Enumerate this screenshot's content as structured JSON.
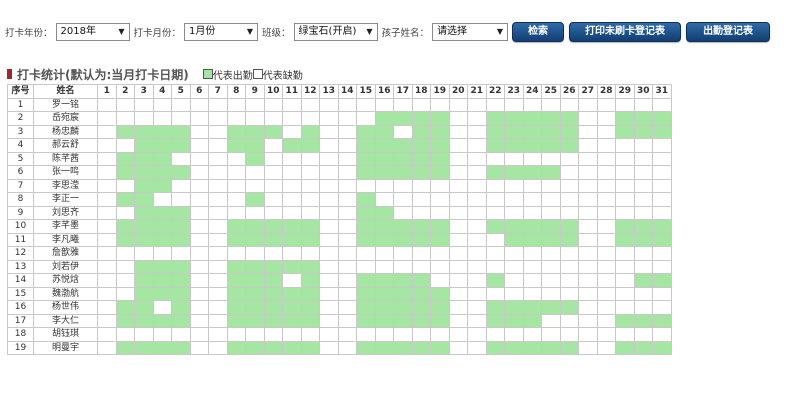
{
  "filters": {
    "year_label": "打卡年份：",
    "year_value": "2018年",
    "month_label": "打卡月份：",
    "month_value": "1月份",
    "class_label": "班级：",
    "class_value": "绿宝石(开启)",
    "child_label": "孩子姓名：",
    "child_value": "请选择"
  },
  "buttons": {
    "search": "检索",
    "print_unpunched": "打印未刷卡登记表",
    "attendance_register": "出勤登记表"
  },
  "section": {
    "title": "打卡统计(默认为:当月打卡日期)",
    "legend_present": "代表出勤",
    "legend_absent": "代表缺勤"
  },
  "colors": {
    "present": "#a6e6a3",
    "absent": "#ffffff",
    "button": "#1f5189",
    "marker": "#9b2b2b"
  },
  "table": {
    "header_index": "序号",
    "header_name": "姓名",
    "days": [
      "1",
      "2",
      "3",
      "4",
      "5",
      "6",
      "7",
      "8",
      "9",
      "10",
      "11",
      "12",
      "13",
      "14",
      "15",
      "16",
      "17",
      "18",
      "19",
      "20",
      "21",
      "22",
      "23",
      "24",
      "25",
      "26",
      "27",
      "28",
      "29",
      "30",
      "31"
    ],
    "rows": [
      {
        "no": "1",
        "name": "罗一铭",
        "present": []
      },
      {
        "no": "2",
        "name": "岳宛宸",
        "present": [
          16,
          17,
          18,
          19,
          22,
          23,
          24,
          25,
          26,
          29,
          30,
          31
        ]
      },
      {
        "no": "3",
        "name": "杨忠麟",
        "present": [
          2,
          3,
          4,
          5,
          8,
          9,
          10,
          12,
          15,
          16,
          18,
          19,
          22,
          23,
          24,
          25,
          26,
          29,
          30,
          31
        ]
      },
      {
        "no": "4",
        "name": "郝云舒",
        "present": [
          3,
          4,
          5,
          8,
          9,
          11,
          12,
          15,
          16,
          17,
          18,
          19,
          22,
          23,
          24,
          25,
          26
        ]
      },
      {
        "no": "5",
        "name": "陈芊茜",
        "present": [
          2,
          3,
          4,
          9,
          15,
          16,
          17,
          18,
          19
        ]
      },
      {
        "no": "6",
        "name": "张一鸣",
        "present": [
          2,
          3,
          4,
          5,
          15,
          16,
          17,
          18,
          19,
          22,
          23,
          24,
          25
        ]
      },
      {
        "no": "7",
        "name": "李思滢",
        "present": [
          3,
          4
        ]
      },
      {
        "no": "8",
        "name": "李正一",
        "present": [
          2,
          3,
          9,
          15
        ]
      },
      {
        "no": "9",
        "name": "刘思齐",
        "present": [
          3,
          4,
          5,
          15,
          16
        ]
      },
      {
        "no": "10",
        "name": "李芊墨",
        "present": [
          2,
          3,
          4,
          5,
          8,
          9,
          10,
          11,
          12,
          15,
          16,
          17,
          18,
          19,
          22,
          23,
          24,
          25,
          26,
          29,
          30,
          31
        ]
      },
      {
        "no": "11",
        "name": "李凡曦",
        "present": [
          2,
          3,
          4,
          5,
          8,
          9,
          10,
          11,
          12,
          15,
          16,
          17,
          18,
          19,
          23,
          24,
          25,
          26,
          29,
          30,
          31
        ]
      },
      {
        "no": "12",
        "name": "詹歆雅",
        "present": []
      },
      {
        "no": "13",
        "name": "刘若伊",
        "present": [
          3,
          4,
          5,
          8,
          9,
          10,
          11,
          12
        ]
      },
      {
        "no": "14",
        "name": "苏悦焓",
        "present": [
          3,
          4,
          5,
          8,
          9,
          10,
          12,
          15,
          16,
          17,
          18,
          22,
          30,
          31
        ]
      },
      {
        "no": "15",
        "name": "魏渤航",
        "present": [
          3,
          4,
          5,
          8,
          9,
          10,
          11,
          12,
          15,
          16,
          17,
          18,
          19
        ]
      },
      {
        "no": "16",
        "name": "杨世伟",
        "present": [
          2,
          3,
          5,
          8,
          9,
          10,
          11,
          12,
          15,
          16,
          17,
          18,
          19,
          22,
          23,
          24,
          25,
          26
        ]
      },
      {
        "no": "17",
        "name": "李大仁",
        "present": [
          2,
          3,
          4,
          5,
          8,
          9,
          10,
          11,
          12,
          15,
          16,
          17,
          18,
          19,
          22,
          23,
          24,
          29,
          30,
          31
        ]
      },
      {
        "no": "18",
        "name": "胡钰琪",
        "present": []
      },
      {
        "no": "19",
        "name": "明曼宇",
        "present": [
          2,
          3,
          4,
          5,
          8,
          9,
          10,
          11,
          12,
          15,
          16,
          17,
          18,
          19,
          22,
          23,
          24,
          25,
          26,
          29,
          30,
          31
        ]
      }
    ]
  }
}
